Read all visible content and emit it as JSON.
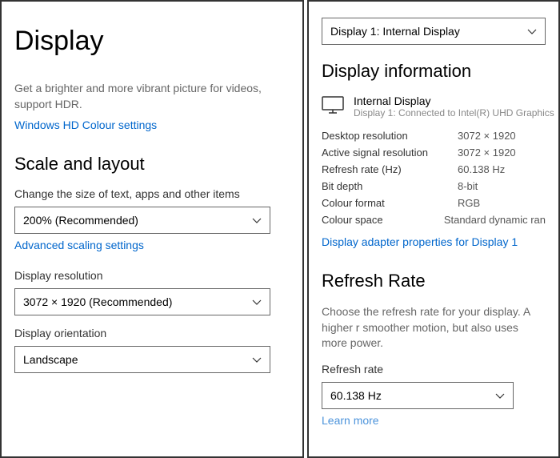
{
  "left": {
    "title": "Display",
    "hdr_text": "Get a brighter and more vibrant picture for videos, support HDR.",
    "hdr_link": "Windows HD Colour settings",
    "scale_heading": "Scale and layout",
    "scale_label": "Change the size of text, apps and other items",
    "scale_value": "200% (Recommended)",
    "advanced_link": "Advanced scaling settings",
    "resolution_label": "Display resolution",
    "resolution_value": "3072 × 1920 (Recommended)",
    "orientation_label": "Display orientation",
    "orientation_value": "Landscape"
  },
  "right": {
    "selector_value": "Display 1: Internal Display",
    "info_heading": "Display information",
    "display_name": "Internal Display",
    "display_sub": "Display 1: Connected to Intel(R) UHD Graphics",
    "props": [
      {
        "k": "Desktop resolution",
        "v": "3072 × 1920"
      },
      {
        "k": "Active signal resolution",
        "v": "3072 × 1920"
      },
      {
        "k": "Refresh rate (Hz)",
        "v": "60.138 Hz"
      },
      {
        "k": "Bit depth",
        "v": "8-bit"
      },
      {
        "k": "Colour format",
        "v": "RGB"
      },
      {
        "k": "Colour space",
        "v": "Standard dynamic ran"
      }
    ],
    "adapter_link": "Display adapter properties for Display 1",
    "refresh_heading": "Refresh Rate",
    "refresh_text": "Choose the refresh rate for your display. A higher r smoother motion, but also uses more power.",
    "refresh_label": "Refresh rate",
    "refresh_value": "60.138 Hz",
    "learn_link": "Learn more"
  }
}
